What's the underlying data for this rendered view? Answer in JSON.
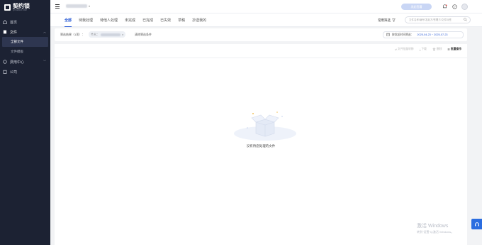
{
  "sidebar": {
    "logo_name": "契约锁",
    "logo_sub": "QIYUESUO.COM",
    "items": [
      {
        "label": "首页",
        "icon": "home-icon"
      },
      {
        "label": "文件",
        "icon": "document-icon"
      },
      {
        "label": "全部文件",
        "icon": ""
      },
      {
        "label": "文件模板",
        "icon": ""
      },
      {
        "label": "费用中心",
        "icon": "billing-icon"
      },
      {
        "label": "公司",
        "icon": "company-icon"
      }
    ]
  },
  "topbar": {
    "primary_button": "发起签署"
  },
  "tabs": [
    "全部",
    "待我处理",
    "待他人处理",
    "未完成",
    "已完成",
    "已失效",
    "草稿",
    "抄送我的"
  ],
  "quick_filter": "常用筛选",
  "search": {
    "placeholder": "文件名称/编号/发起方/签署方/文件标签"
  },
  "filter": {
    "label": "筛选结果（1项）：",
    "chip_prefix": "个人：",
    "clear": "清除筛选条件"
  },
  "date_filter": {
    "label": "按发起时间筛选：",
    "range": "2025-04-23 ~ 2025-07-23"
  },
  "actions": [
    {
      "label": "文件批量转移",
      "icon": "transfer-icon"
    },
    {
      "label": "下载",
      "icon": "download-icon"
    },
    {
      "label": "删除",
      "icon": "delete-icon"
    },
    {
      "label": "批量操作",
      "icon": "batch-icon"
    }
  ],
  "empty_state": {
    "text": "没有待您处理的文件"
  },
  "watermark": {
    "line1": "激活 Windows",
    "line2": "转到\"设置\"以激活 Windows。"
  },
  "colors": {
    "accent": "#2b5cd6",
    "sidebar_bg": "#1c2233",
    "page_bg": "#f2f3f5"
  }
}
